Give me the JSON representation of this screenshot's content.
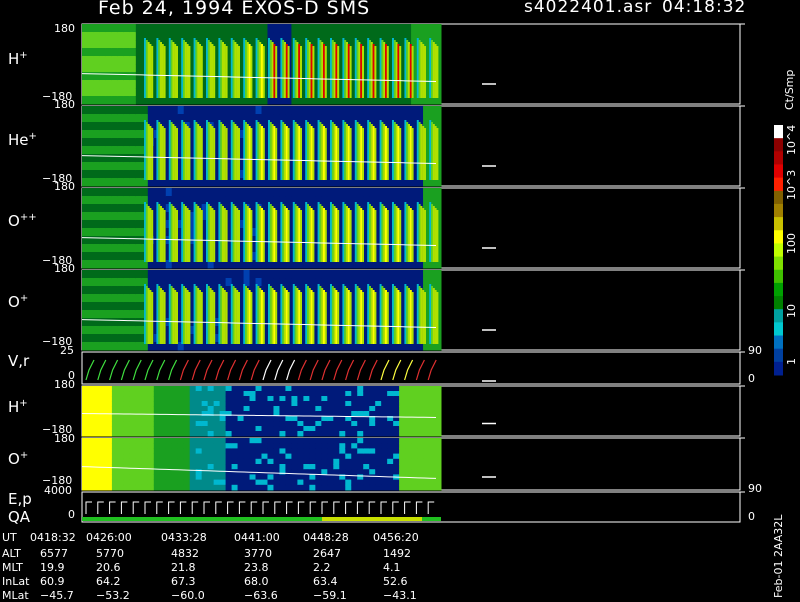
{
  "header": {
    "title": "Feb 24, 1994   EXOS-D SMS",
    "file": "s4022401.asr",
    "time": "04:18:32"
  },
  "chart_data": {
    "type": "heatmap",
    "panels": [
      {
        "id": "hplus",
        "label": "H",
        "sup": "+",
        "ymax": "180",
        "ymin": "−180"
      },
      {
        "id": "heplus",
        "label": "He",
        "sup": "+",
        "ymax": "180",
        "ymin": "−180"
      },
      {
        "id": "oplusplus",
        "label": "O",
        "sup": "++",
        "ymax": "180",
        "ymin": "−180"
      },
      {
        "id": "oplus",
        "label": "O",
        "sup": "+",
        "ymax": "180",
        "ymin": "−180"
      },
      {
        "id": "vr",
        "label": "V,r",
        "sup": "",
        "ymax": "25",
        "ymin": "0",
        "right_top": "90",
        "right_bottom": "0"
      },
      {
        "id": "hplus2",
        "label": "H",
        "sup": "+",
        "ymax": "180",
        "ymin": "−180"
      },
      {
        "id": "oplus2",
        "label": "O",
        "sup": "+",
        "ymax": "180",
        "ymin": "−180"
      },
      {
        "id": "ep",
        "label": "E,p",
        "sup": "",
        "label2": "QA",
        "ymax": "4000",
        "ymin": "0",
        "right_top": "90",
        "right_bottom": "0"
      }
    ],
    "colorbar": {
      "unit": "Ct/Smp",
      "ticks": [
        "10^4",
        "10^3",
        "100",
        "10",
        "1"
      ],
      "colors": [
        "#ffffff",
        "#8b0000",
        "#b00000",
        "#e00000",
        "#ff2000",
        "#806000",
        "#a08000",
        "#c8c000",
        "#ffff00",
        "#c0ff00",
        "#80e000",
        "#40c000",
        "#00a000",
        "#008000",
        "#00a0a0",
        "#00c8d0",
        "#0070c0",
        "#0040a0",
        "#002090"
      ]
    },
    "time_axis": {
      "rows": [
        {
          "name": "UT",
          "values": [
            "0418:32",
            "0426:00",
            "0433:28",
            "0441:00",
            "0448:28",
            "0456:20"
          ]
        },
        {
          "name": "ALT",
          "values": [
            "6577",
            "5770",
            "4832",
            "3770",
            "2647",
            "1492"
          ]
        },
        {
          "name": "MLT",
          "values": [
            "19.9",
            "20.6",
            "21.8",
            "23.8",
            "2.2",
            "4.1"
          ]
        },
        {
          "name": "InLat",
          "values": [
            "60.9",
            "64.2",
            "67.3",
            "68.0",
            "63.4",
            "52.6"
          ]
        },
        {
          "name": "MLat",
          "values": [
            "−45.7",
            "−53.2",
            "−60.0",
            "−63.6",
            "−59.1",
            "−43.1"
          ]
        }
      ]
    },
    "side_note": "Feb-01  2AA32L"
  }
}
